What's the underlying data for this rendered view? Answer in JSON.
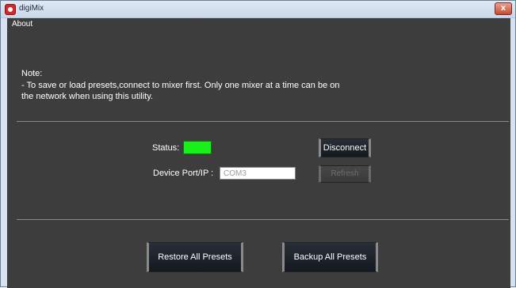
{
  "window": {
    "title": "digiMix",
    "close_glyph": "x"
  },
  "menu": {
    "items": [
      {
        "label": "About"
      }
    ]
  },
  "note": {
    "title": "Note:",
    "line1": "- To save or load presets,connect to mixer first. Only one mixer at a time can be on",
    "line2": "the network when using this utility."
  },
  "connection": {
    "status_label": "Status:",
    "status_color": "#19f019",
    "port_label": "Device Port/IP :",
    "port_value": "COM3",
    "disconnect_label": "Disconnect",
    "refresh_label": "Refresh"
  },
  "presets": {
    "restore_label": "Restore All Presets",
    "backup_label": "Backup All Presets"
  }
}
